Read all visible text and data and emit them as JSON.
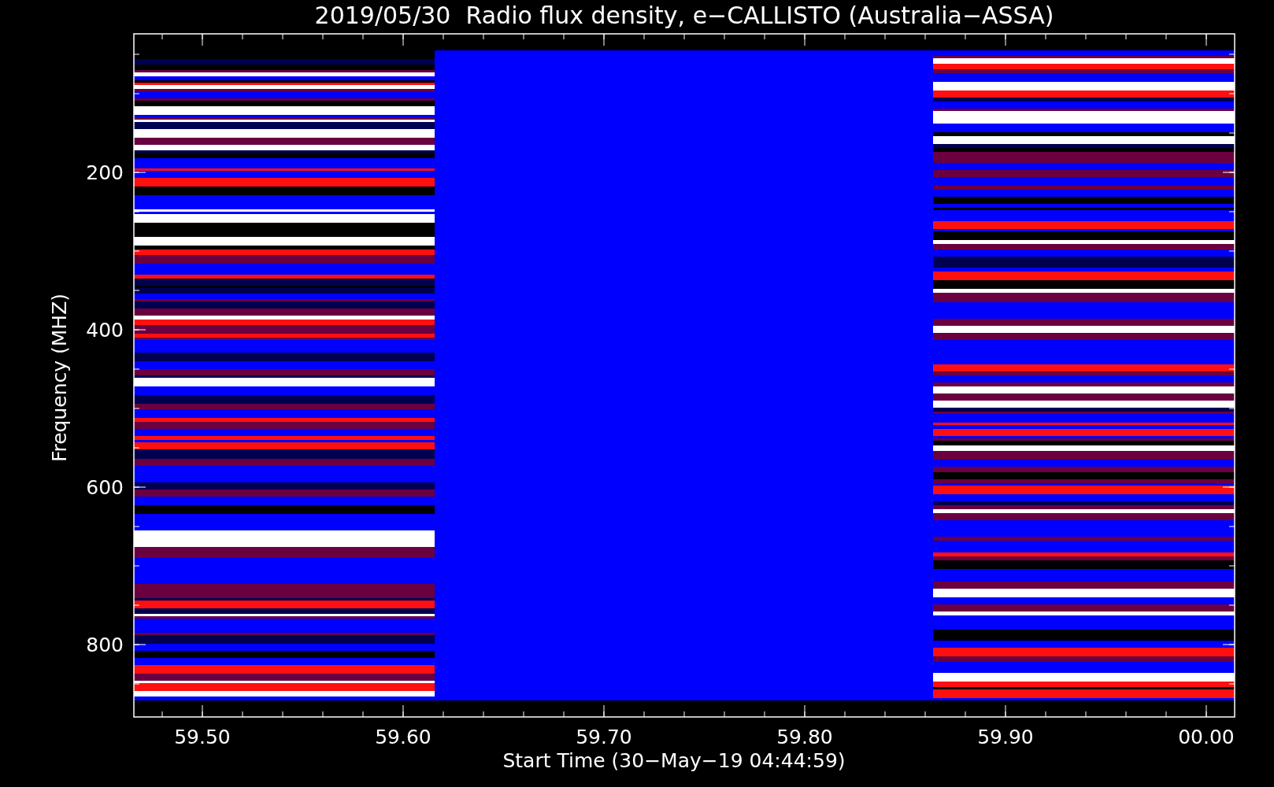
{
  "title": "2019/05/30  Radio flux density, e−CALLISTO (Australia−ASSA)",
  "y_axis": {
    "label": "Frequency (MHZ)",
    "ticks": [
      "200",
      "400",
      "600",
      "800"
    ]
  },
  "x_axis": {
    "label": "Start Time (30−May−19 04:44:59)",
    "ticks": [
      "59.50",
      "59.60",
      "59.70",
      "59.80",
      "59.90",
      "00.00"
    ]
  }
}
